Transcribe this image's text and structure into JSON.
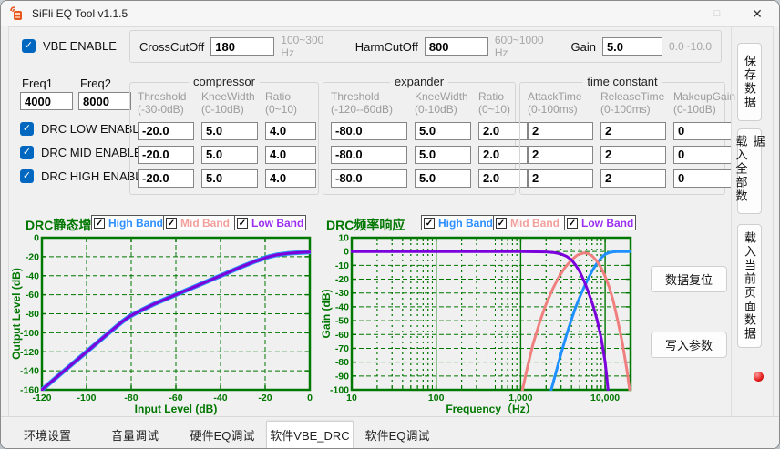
{
  "window": {
    "title": "SiFli EQ Tool v1.1.5",
    "minimize": "—",
    "maximize": "□",
    "close": "✕"
  },
  "vbe": {
    "enable_label": "VBE ENABLE",
    "crosscutoff_label": "CrossCutOff",
    "crosscutoff_value": "180",
    "crosscutoff_hint": "100~300 Hz",
    "harmcutoff_label": "HarmCutOff",
    "harmcutoff_value": "800",
    "harmcutoff_hint": "600~1000 Hz",
    "gain_label": "Gain",
    "gain_value": "5.0",
    "gain_hint": "0.0~10.0"
  },
  "freq": {
    "freq1_label": "Freq1",
    "freq1_value": "4000",
    "freq2_label": "Freq2",
    "freq2_value": "8000"
  },
  "drc_enable": {
    "low": "DRC LOW ENABLE",
    "mid": "DRC MID ENABLE",
    "high": "DRC HIGH ENABLE"
  },
  "compressor": {
    "title": "compressor",
    "headers": [
      [
        "Threshold",
        "(-30-0dB)"
      ],
      [
        "KneeWidth",
        "(0-10dB)"
      ],
      [
        "Ratio",
        "(0~10)"
      ]
    ],
    "rows": [
      [
        "-20.0",
        "5.0",
        "4.0"
      ],
      [
        "-20.0",
        "5.0",
        "4.0"
      ],
      [
        "-20.0",
        "5.0",
        "4.0"
      ]
    ]
  },
  "expander": {
    "title": "expander",
    "headers": [
      [
        "Threshold",
        "(-120--60dB)"
      ],
      [
        "KneeWidth",
        "(0-10dB)"
      ],
      [
        "Ratio",
        "(0~10)"
      ]
    ],
    "rows": [
      [
        "-80.0",
        "5.0",
        "2.0"
      ],
      [
        "-80.0",
        "5.0",
        "2.0"
      ],
      [
        "-80.0",
        "5.0",
        "2.0"
      ]
    ]
  },
  "time_constant": {
    "title": "time constant",
    "headers": [
      [
        "AttackTime",
        "(0-100ms)"
      ],
      [
        "ReleaseTime",
        "(0-100ms)"
      ],
      [
        "MakeupGain",
        "(0-10dB)"
      ]
    ],
    "rows": [
      [
        "2",
        "2",
        "0"
      ],
      [
        "2",
        "2",
        "0"
      ],
      [
        "2",
        "2",
        "0"
      ]
    ]
  },
  "bands": [
    {
      "label": "High Band",
      "color": "#2E8FFF",
      "checked": true
    },
    {
      "label": "Mid Band",
      "color": "#F2A09C",
      "checked": true
    },
    {
      "label": "Low Band",
      "color": "#9B30F0",
      "checked": true
    }
  ],
  "buttons": {
    "save": "保存数据",
    "load_all": "载入全部数据",
    "load_page": "载入当前页面数据",
    "reset": "数据复位",
    "write": "写入参数"
  },
  "status_led_color": "#E02020",
  "tabs": [
    {
      "label": "环境设置",
      "active": false
    },
    {
      "label": "音量调试",
      "active": false
    },
    {
      "label": "硬件EQ调试",
      "active": false
    },
    {
      "label": "软件VBE_DRC",
      "active": true
    },
    {
      "label": "软件EQ调试",
      "active": false
    }
  ],
  "chart_data": [
    {
      "type": "line",
      "title": "DRC静态增益",
      "xlabel": "Input Level (dB)",
      "ylabel": "Output Level (dB)",
      "xscale": "linear",
      "xlim": [
        -120,
        0
      ],
      "ylim": [
        -160,
        0
      ],
      "xticks": [
        -120,
        -100,
        -80,
        -60,
        -40,
        -20,
        0
      ],
      "xtick_labels": [
        "-120",
        "-100",
        "-80",
        "-60",
        "-40",
        "-20",
        "0"
      ],
      "yticks": [
        0,
        -20,
        -40,
        -60,
        -80,
        -100,
        -120,
        -140,
        -160
      ],
      "ytick_labels": [
        "0",
        "-20",
        "-40",
        "-60",
        "-80",
        "-100",
        "-120",
        "-140",
        "-160"
      ],
      "grid": true,
      "legend": "band checkboxes above plot",
      "axis_color": "#007700",
      "series": [
        {
          "name": "High Band",
          "color": "#1E90FF",
          "width": 5,
          "points": [
            [
              -120,
              -160
            ],
            [
              -110,
              -140
            ],
            [
              -100,
              -120
            ],
            [
              -90,
              -100
            ],
            [
              -84,
              -88.3
            ],
            [
              -81,
              -83.2
            ],
            [
              -78,
              -79.3
            ],
            [
              -74,
              -74.6
            ],
            [
              -70,
              -70
            ],
            [
              -60,
              -60
            ],
            [
              -50,
              -50
            ],
            [
              -40,
              -40
            ],
            [
              -30,
              -30
            ],
            [
              -25,
              -25.3
            ],
            [
              -22,
              -22.9
            ],
            [
              -20,
              -21.2
            ],
            [
              -18,
              -19.8
            ],
            [
              -15,
              -18.1
            ],
            [
              -10,
              -16.6
            ],
            [
              -5,
              -15.7
            ],
            [
              0,
              -15
            ]
          ]
        },
        {
          "name": "Mid Band",
          "color": "#F08080",
          "width": 3,
          "points": [
            [
              -120,
              -160
            ],
            [
              -110,
              -140
            ],
            [
              -100,
              -120
            ],
            [
              -90,
              -100
            ],
            [
              -84,
              -88.3
            ],
            [
              -81,
              -83.2
            ],
            [
              -78,
              -79.3
            ],
            [
              -74,
              -74.6
            ],
            [
              -70,
              -70
            ],
            [
              -60,
              -60
            ],
            [
              -50,
              -50
            ],
            [
              -40,
              -40
            ],
            [
              -30,
              -30
            ],
            [
              -25,
              -25.3
            ],
            [
              -22,
              -22.9
            ],
            [
              -20,
              -21.2
            ],
            [
              -18,
              -19.8
            ],
            [
              -15,
              -18.1
            ],
            [
              -10,
              -16.6
            ],
            [
              -5,
              -15.7
            ],
            [
              0,
              -15
            ]
          ]
        },
        {
          "name": "Low Band",
          "color": "#7A00DC",
          "width": 3,
          "points": [
            [
              -120,
              -160
            ],
            [
              -110,
              -140
            ],
            [
              -100,
              -120
            ],
            [
              -90,
              -100
            ],
            [
              -84,
              -88.3
            ],
            [
              -81,
              -83.2
            ],
            [
              -78,
              -79.3
            ],
            [
              -74,
              -74.6
            ],
            [
              -70,
              -70
            ],
            [
              -60,
              -60
            ],
            [
              -50,
              -50
            ],
            [
              -40,
              -40
            ],
            [
              -30,
              -30
            ],
            [
              -25,
              -25.3
            ],
            [
              -22,
              -22.9
            ],
            [
              -20,
              -21.2
            ],
            [
              -18,
              -19.8
            ],
            [
              -15,
              -18.1
            ],
            [
              -10,
              -16.6
            ],
            [
              -5,
              -15.7
            ],
            [
              0,
              -15
            ]
          ]
        }
      ]
    },
    {
      "type": "line",
      "title": "DRC频率响应",
      "xlabel": "Frequency（Hz）",
      "ylabel": "Gain (dB)",
      "xscale": "log",
      "xlim": [
        10,
        20000
      ],
      "ylim": [
        -100,
        10
      ],
      "xticks": [
        10,
        100,
        1000,
        10000
      ],
      "xtick_labels": [
        "10",
        "100",
        "1,000",
        "10,000"
      ],
      "yticks": [
        10,
        0,
        -10,
        -20,
        -30,
        -40,
        -50,
        -60,
        -70,
        -80,
        -90,
        -100
      ],
      "ytick_labels": [
        "10",
        "0",
        "-10",
        "-20",
        "-30",
        "-40",
        "-50",
        "-60",
        "-70",
        "-80",
        "-90",
        "-100"
      ],
      "grid": true,
      "legend": "band checkboxes above plot",
      "axis_color": "#007700",
      "series": [
        {
          "name": "High Band",
          "color": "#1E90FF",
          "width": 3,
          "points": [
            [
              2300,
              -100
            ],
            [
              2600,
              -88
            ],
            [
              3000,
              -74
            ],
            [
              3500,
              -60
            ],
            [
              4000,
              -49
            ],
            [
              4500,
              -40
            ],
            [
              5000,
              -33
            ],
            [
              5600,
              -26
            ],
            [
              6300,
              -19.5
            ],
            [
              7100,
              -13.5
            ],
            [
              8000,
              -8.5
            ],
            [
              9000,
              -4.5
            ],
            [
              10000,
              -2
            ],
            [
              11200,
              -0.8
            ],
            [
              12500,
              -0.2
            ],
            [
              14000,
              0
            ],
            [
              20000,
              0
            ]
          ]
        },
        {
          "name": "Mid Band",
          "color": "#F08080",
          "width": 3,
          "points": [
            [
              1050,
              -100
            ],
            [
              1200,
              -84
            ],
            [
              1400,
              -67
            ],
            [
              1700,
              -50
            ],
            [
              2000,
              -38
            ],
            [
              2400,
              -27
            ],
            [
              2800,
              -19
            ],
            [
              3300,
              -12
            ],
            [
              4000,
              -6
            ],
            [
              4700,
              -2.5
            ],
            [
              5600,
              -1
            ],
            [
              6300,
              -1.5
            ],
            [
              7100,
              -3.5
            ],
            [
              8000,
              -7
            ],
            [
              9000,
              -12
            ],
            [
              10000,
              -18
            ],
            [
              11200,
              -26
            ],
            [
              12500,
              -36
            ],
            [
              14000,
              -49
            ],
            [
              16000,
              -66
            ],
            [
              18000,
              -85
            ],
            [
              19000,
              -95
            ],
            [
              19500,
              -100
            ]
          ]
        },
        {
          "name": "Low Band",
          "color": "#7A00DC",
          "width": 3,
          "points": [
            [
              10,
              0
            ],
            [
              1000,
              0
            ],
            [
              2000,
              -0.3
            ],
            [
              2500,
              -0.8
            ],
            [
              3000,
              -1.8
            ],
            [
              3500,
              -3.5
            ],
            [
              4000,
              -6
            ],
            [
              4500,
              -10
            ],
            [
              5000,
              -14.5
            ],
            [
              5600,
              -21
            ],
            [
              6300,
              -29
            ],
            [
              7100,
              -38
            ],
            [
              8000,
              -49
            ],
            [
              9000,
              -63
            ],
            [
              10000,
              -80
            ],
            [
              10500,
              -92
            ],
            [
              10800,
              -100
            ]
          ]
        }
      ]
    }
  ]
}
